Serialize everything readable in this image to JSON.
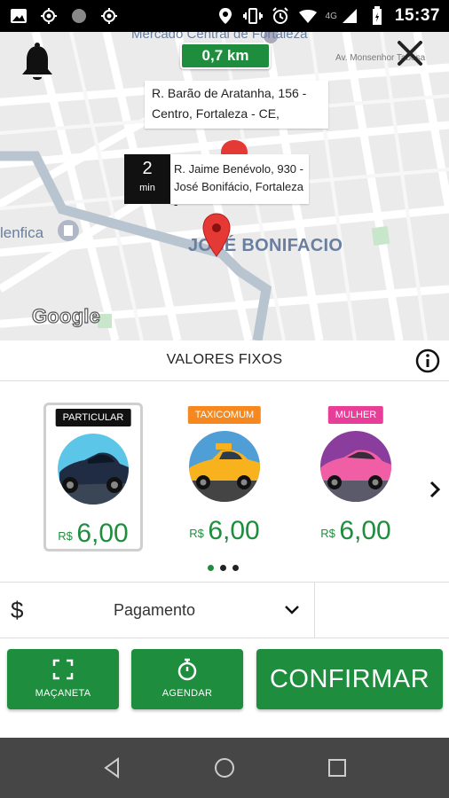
{
  "status_bar": {
    "network": "4G",
    "time": "15:37",
    "icons": [
      "image-icon",
      "gps-icon",
      "circle-icon",
      "gps-icon-2",
      "location-icon",
      "vibrate-icon",
      "alarm-icon",
      "wifi-icon",
      "signal-icon",
      "battery-icon"
    ]
  },
  "map": {
    "distance": "0,7 km",
    "pickup_address_line1": "R. Barão de Aratanha, 156 -",
    "pickup_address_line2": "Centro, Fortaleza - CE,",
    "eta_value": "2",
    "eta_unit": "min",
    "dest_address_line1": "R. Jaime Benévolo, 930 -",
    "dest_address_line2": "José Bonifácio, Fortaleza -",
    "label_neighborhood": "JOSÉ BONIFACIO",
    "label_left": "lenfica",
    "label_top": "Mercado Central de Fortaleza",
    "label_street": "Av. Monsenhor Tabosa",
    "logo": "Google"
  },
  "header": {
    "title": "VALORES FIXOS"
  },
  "vehicle_options": [
    {
      "label": "PARTICULAR",
      "currency": "R$",
      "price": "6,00",
      "label_bg": "#111111",
      "label_fg": "#ffffff",
      "selected": true,
      "icon": "car-dark-icon"
    },
    {
      "label": "TAXICOMUM",
      "currency": "R$",
      "price": "6,00",
      "label_bg": "#f5891f",
      "label_fg": "#ffffff",
      "selected": false,
      "icon": "taxi-icon"
    },
    {
      "label": "MULHER",
      "currency": "R$",
      "price": "6,00",
      "label_bg": "#e83e9a",
      "label_fg": "#ffffff",
      "selected": false,
      "icon": "car-pink-icon"
    }
  ],
  "carousel": {
    "pages": 3,
    "active_page": 1
  },
  "payment": {
    "symbol": "$",
    "label": "Pagamento"
  },
  "actions": {
    "handle_label": "MAÇANETA",
    "schedule_label": "AGENDAR",
    "confirm_label": "CONFIRMAR"
  },
  "colors": {
    "primary_green": "#1e8e3e",
    "nav_bar": "#464646"
  }
}
